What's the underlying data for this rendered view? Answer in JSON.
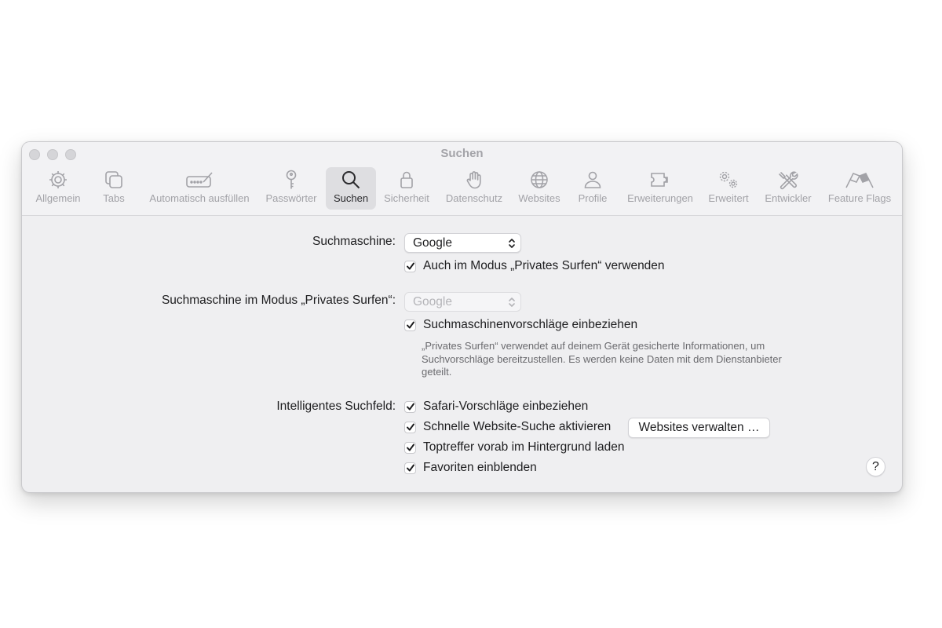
{
  "window": {
    "title": "Suchen"
  },
  "tabs": [
    {
      "label": "Allgemein",
      "icon": "gear-icon"
    },
    {
      "label": "Tabs",
      "icon": "tabs-icon"
    },
    {
      "label": "Automatisch ausfüllen",
      "icon": "autofill-icon"
    },
    {
      "label": "Passwörter",
      "icon": "key-icon"
    },
    {
      "label": "Suchen",
      "icon": "search-icon",
      "active": true
    },
    {
      "label": "Sicherheit",
      "icon": "lock-icon"
    },
    {
      "label": "Datenschutz",
      "icon": "hand-icon"
    },
    {
      "label": "Websites",
      "icon": "globe-icon"
    },
    {
      "label": "Profile",
      "icon": "person-icon"
    },
    {
      "label": "Erweiterungen",
      "icon": "puzzle-icon"
    },
    {
      "label": "Erweitert",
      "icon": "gears-icon"
    },
    {
      "label": "Entwickler",
      "icon": "tools-icon"
    },
    {
      "label": "Feature Flags",
      "icon": "flags-icon"
    }
  ],
  "search_engine": {
    "label": "Suchmaschine:",
    "value": "Google",
    "use_in_private_label": "Auch im Modus „Privates Surfen“ verwenden",
    "use_in_private_checked": true
  },
  "private_search_engine": {
    "label": "Suchmaschine im Modus „Privates Surfen“:",
    "value": "Google",
    "disabled": true
  },
  "suggestions": {
    "label": "Suchmaschinenvorschläge einbeziehen",
    "checked": true,
    "note": "„Privates Surfen“ verwendet auf deinem Gerät gesicherte Informationen, um Suchvorschläge bereitzustellen. Es werden keine Daten mit dem Dienstanbieter geteilt."
  },
  "smart_search_field": {
    "label": "Intelligentes Suchfeld:",
    "options": [
      {
        "label": "Safari-Vorschläge einbeziehen",
        "checked": true
      },
      {
        "label": "Schnelle Website-Suche aktivieren",
        "checked": true
      },
      {
        "label": "Toptreffer vorab im Hintergrund laden",
        "checked": true
      },
      {
        "label": "Favoriten einblenden",
        "checked": true
      }
    ],
    "manage_websites_label": "Websites verwalten …"
  },
  "help": {
    "label": "?"
  }
}
